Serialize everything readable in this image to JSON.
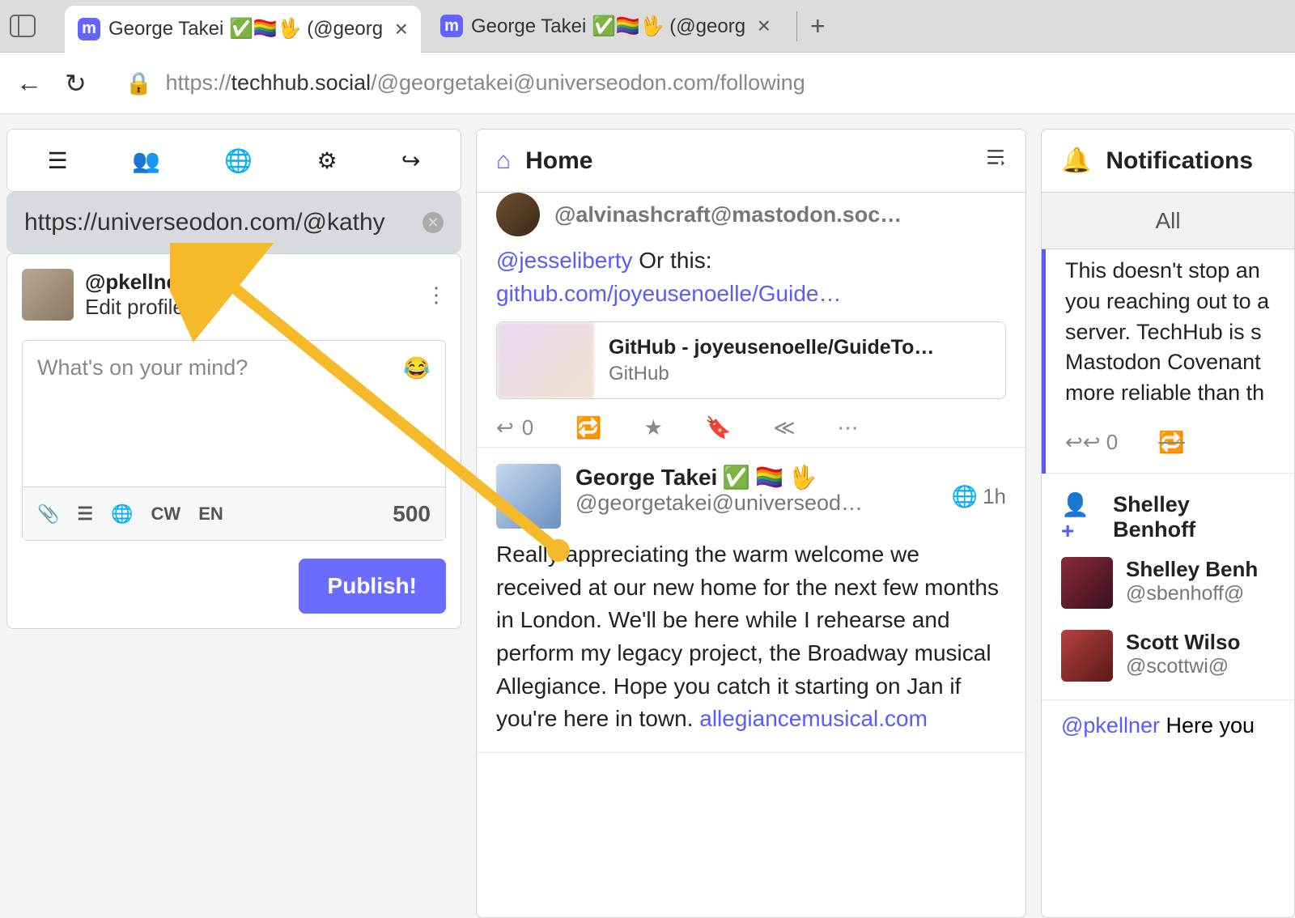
{
  "browser": {
    "tab1_title": "George Takei ✅🏳️‍🌈🖖 (@georg",
    "tab2_title": "George Takei ✅🏳️‍🌈🖖 (@georg",
    "url_prefix": "https://",
    "url_host": "techhub.social",
    "url_path": "/@georgetakei@universeodon.com/following"
  },
  "search": {
    "value": "https://universeodon.com/@kathy"
  },
  "profile": {
    "handle": "@pkellner",
    "edit": "Edit profile"
  },
  "compose": {
    "placeholder": "What's on your mind?",
    "cw": "CW",
    "lang": "EN",
    "chars": "500",
    "publish": "Publish!"
  },
  "home": {
    "title": "Home",
    "partial_handle": "@alvinashcraft@mastodon.soc…",
    "reply_mention": "@jesseliberty",
    "reply_text": " Or this:",
    "reply_link": "github.com/joyeusenoelle/Guide…",
    "card_title": "GitHub - joyeusenoelle/GuideTo…",
    "card_site": "GitHub",
    "reply_count": "0",
    "post_name": "George Takei ",
    "post_handle": "@georgetakei@universeod…",
    "post_time": "1h",
    "post_body": "Really appreciating the warm welcome we received at our new home for the next few months in London. We'll be here while I rehearse and perform my legacy project, the Broadway musical Allegiance. Hope you catch it starting on Jan if you're here in town. ",
    "post_link": "allegiancemusical.com"
  },
  "notifications": {
    "title": "Notifications",
    "tab_all": "All",
    "body": "This doesn't stop an you reaching out to a server. TechHub is s Mastodon Covenant more reliable than th",
    "reply_count": "0",
    "follow1_name": "Shelley Benhoff",
    "user1_name": "Shelley Benh",
    "user1_handle": "@sbenhoff@",
    "user2_name": "Scott Wilso",
    "user2_handle": "@scottwi@",
    "mention": "@pkellner",
    "mention_after": " Here you"
  }
}
